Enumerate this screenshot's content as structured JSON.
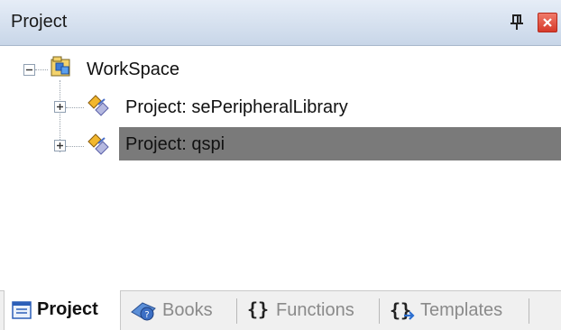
{
  "panel": {
    "title": "Project",
    "pin_icon": "pin-icon",
    "close_icon": "close-icon"
  },
  "tree": {
    "root": {
      "label": "WorkSpace",
      "icon": "workspace-icon",
      "expanded": true
    },
    "children": [
      {
        "label": "Project: sePeripheralLibrary",
        "icon": "project-icon",
        "expanded": false,
        "selected": false
      },
      {
        "label": "Project: qspi",
        "icon": "project-icon",
        "expanded": false,
        "selected": true
      }
    ]
  },
  "tabs": [
    {
      "label": "Project",
      "icon": "project-tab-icon",
      "active": true
    },
    {
      "label": "Books",
      "icon": "books-icon",
      "active": false
    },
    {
      "label": "Functions",
      "icon": "functions-icon",
      "active": false
    },
    {
      "label": "Templates",
      "icon": "templates-icon",
      "active": false
    }
  ],
  "colors": {
    "selection": "#7a7a7a",
    "close_button": "#d63a2a",
    "inactive_tab_text": "#8a8a8a"
  }
}
